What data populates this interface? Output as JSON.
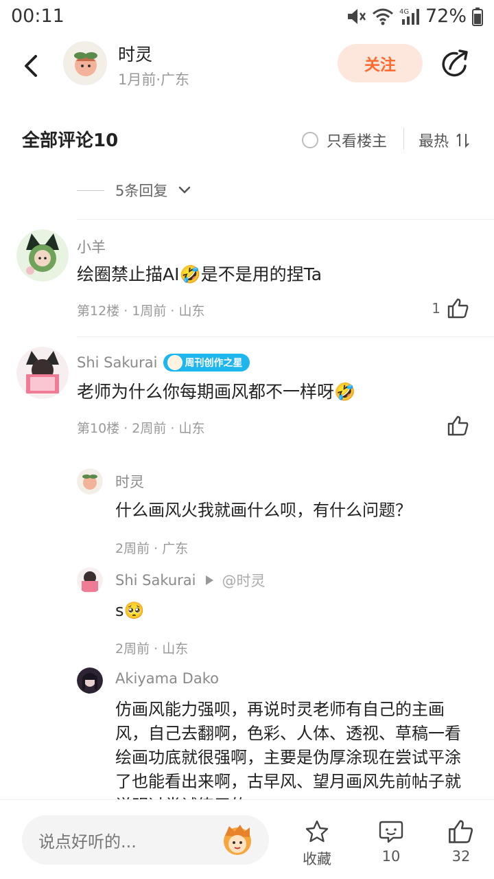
{
  "status_bar": {
    "time": "00:11",
    "battery": "72%",
    "network": "4G"
  },
  "header": {
    "author_name": "时灵",
    "author_meta": "1月前·广东",
    "follow_label": "关注"
  },
  "comments_header": {
    "title": "全部评论10",
    "only_op_label": "只看楼主",
    "sort_label": "最热"
  },
  "collapsed_replies": {
    "label": "5条回复"
  },
  "comments": [
    {
      "user": "小羊",
      "text": "绘圈禁止描AI🤣是不是用的捏Ta",
      "meta": "第12楼 · 1周前 · 山东",
      "likes": "1"
    },
    {
      "user": "Shi Sakurai",
      "badge": "周刊创作之星",
      "text": "老师为什么你每期画风都不一样呀🤣",
      "meta": "第10楼 · 2周前 · 山东",
      "likes": "",
      "replies": [
        {
          "user": "时灵",
          "text": "什么画风火我就画什么呗，有什么问题？",
          "meta": "2周前 · 广东"
        },
        {
          "user": "Shi Sakurai",
          "reply_to": "@时灵",
          "text": "s🥺",
          "meta": "2周前 · 山东"
        },
        {
          "user": "Akiyama Dako",
          "text": "仿画风能力强呗，再说时灵老师有自己的主画风，自己去翻啊，色彩、人体、透视、草稿一看绘画功底就很强啊，主要是伪厚涂现在尝试平涂了也能看出来啊，古早风、望月画风先前帖子就说明过尝试练习的"
        }
      ]
    }
  ],
  "bottom_bar": {
    "input_placeholder": "说点好听的...",
    "favorite_label": "收藏",
    "comment_count": "10",
    "like_count": "32"
  },
  "colors": {
    "accent": "#ff6a2f",
    "follow_bg": "#fde7dd",
    "badge": "#1fb6ee"
  }
}
